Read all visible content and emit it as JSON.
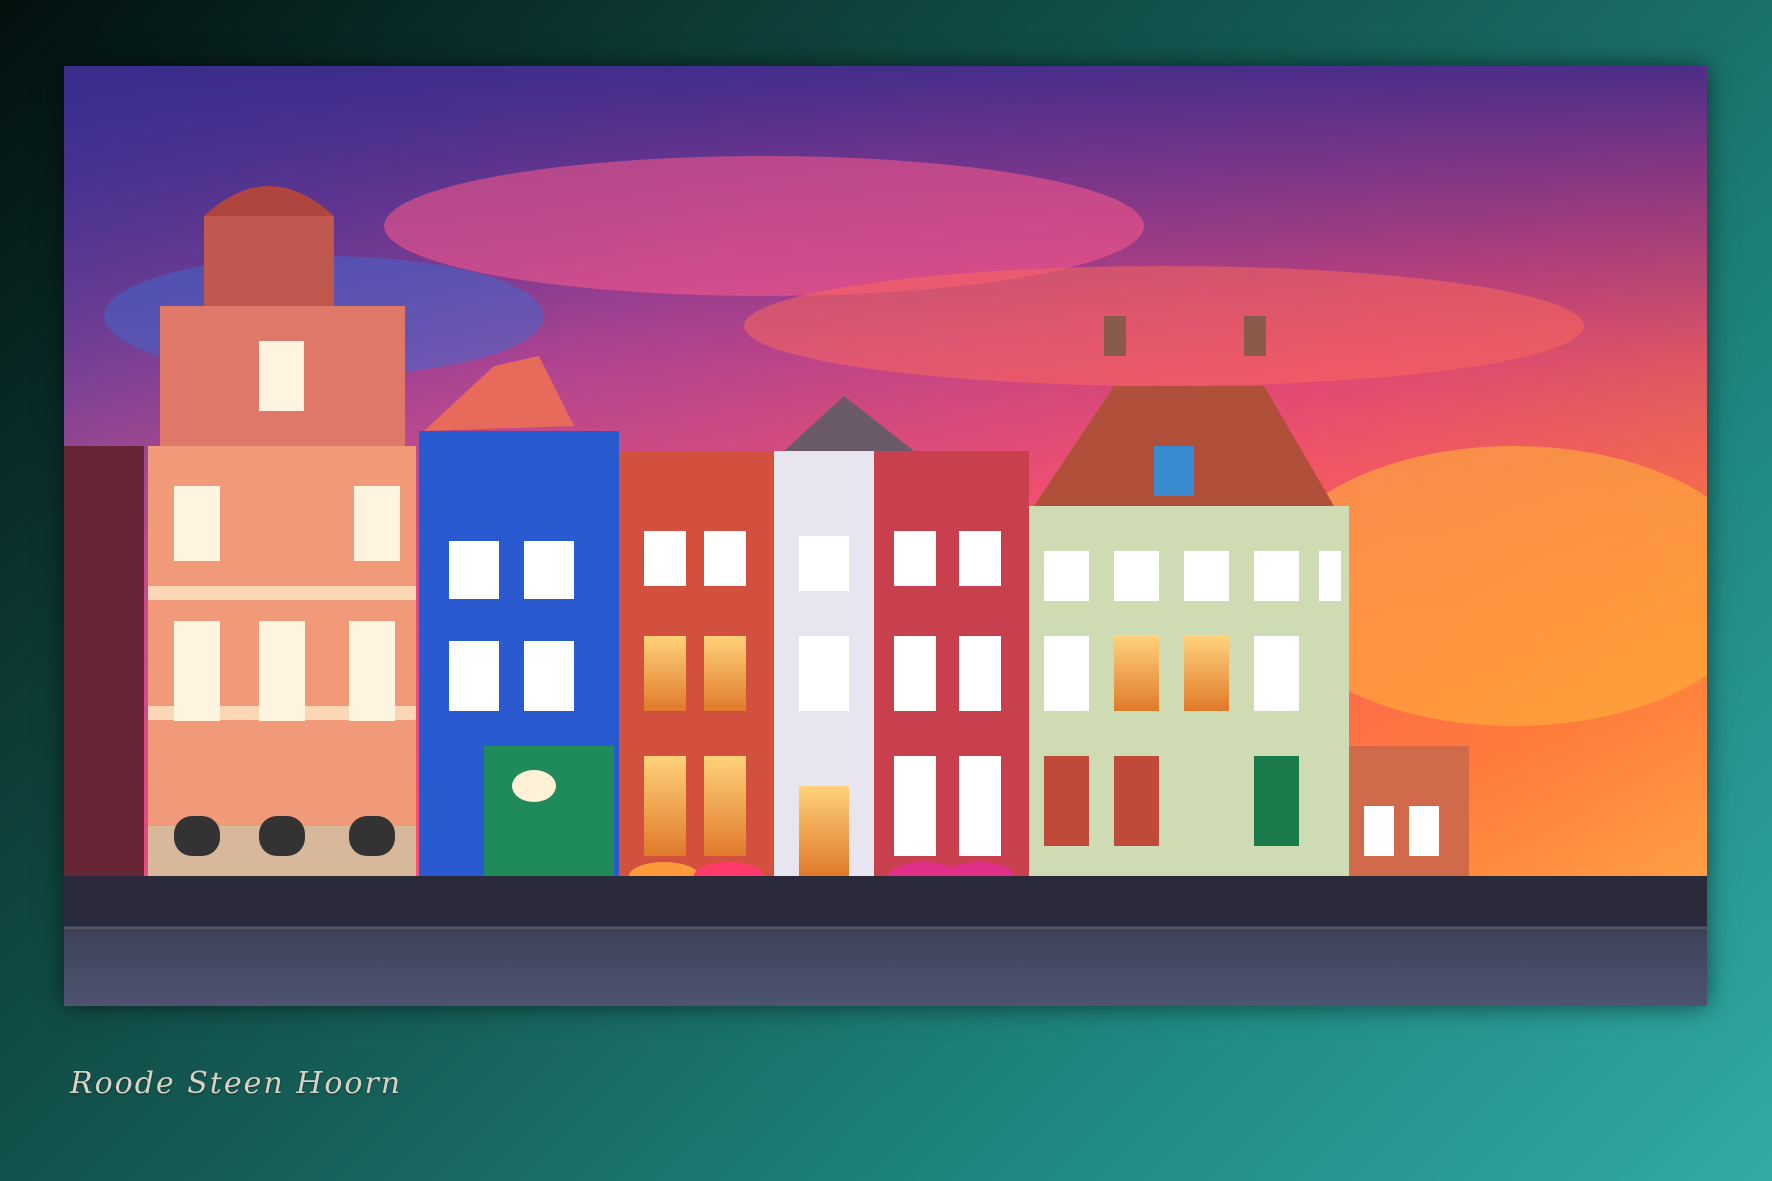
{
  "caption": "Roode Steen Hoorn",
  "palette": {
    "frame_gradient": [
      "#03100e",
      "#32aaa5"
    ],
    "sky": [
      "#3a4fa8",
      "#ff4f7b",
      "#ff8a3c",
      "#6d2a8a"
    ],
    "caption_color": "#d9d2c4"
  }
}
